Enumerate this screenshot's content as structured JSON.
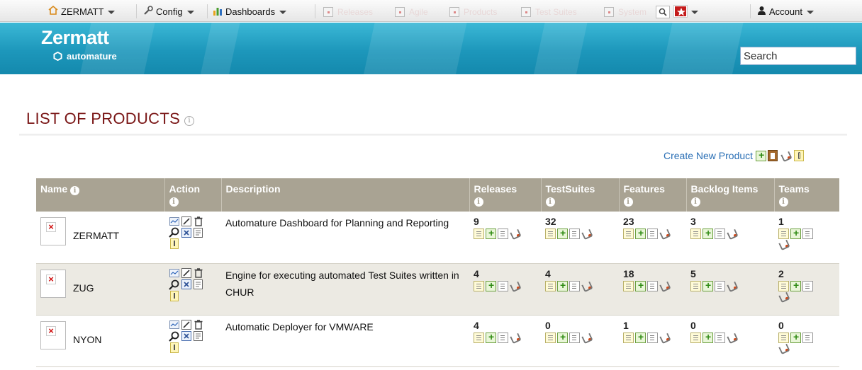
{
  "menu": {
    "zermatt": "ZERMATT",
    "config": "Config",
    "dashboards": "Dashboards",
    "ghost_items": [
      "Releases",
      "Agile",
      "Products",
      "Test Suites",
      "System"
    ],
    "account": "Account"
  },
  "banner": {
    "brand": "Zermatt",
    "brand_sub": "automature",
    "search_value": "Search"
  },
  "page": {
    "title": "LIST OF PRODUCTS",
    "create_link": "Create New Product"
  },
  "table": {
    "headers": {
      "name": "Name",
      "action": "Action",
      "description": "Description",
      "releases": "Releases",
      "testsuites": "TestSuites",
      "features": "Features",
      "backlog": "Backlog Items",
      "teams": "Teams"
    },
    "rows": [
      {
        "name": "ZERMATT",
        "description": "Automature Dashboard for Planning and Reporting",
        "releases": "9",
        "testsuites": "32",
        "features": "23",
        "backlog": "3",
        "teams": "1"
      },
      {
        "name": "ZUG",
        "description": "Engine for executing automated Test Suites written in CHUR",
        "releases": "4",
        "testsuites": "4",
        "features": "18",
        "backlog": "5",
        "teams": "2"
      },
      {
        "name": "NYON",
        "description": "Automatic Deployer for VMWARE",
        "releases": "4",
        "testsuites": "0",
        "features": "1",
        "backlog": "0",
        "teams": "0"
      }
    ]
  },
  "icons": {
    "home": "home-icon",
    "wrench": "wrench-icon",
    "chart": "bar-chart-icon",
    "search": "magnifier-icon",
    "star": "star-icon",
    "user": "user-icon",
    "info": "info-icon",
    "add": "add-icon",
    "delete": "delete-icon"
  },
  "colors": {
    "header_bg": "#a9a393",
    "title": "#7a1616",
    "banner": "#1d97bb",
    "link": "#2a6fb5",
    "alt_row": "#eceae3"
  }
}
